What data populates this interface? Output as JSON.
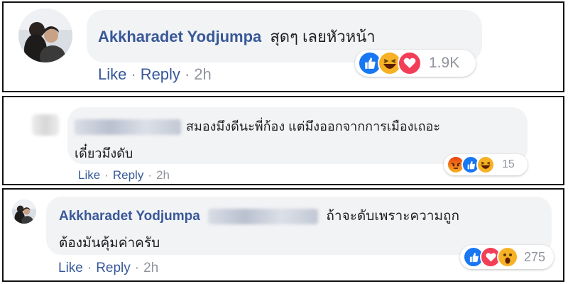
{
  "comments": [
    {
      "author": "Akkharadet Yodjumpa",
      "text": "สุดๆ เลยหัวหน้า",
      "actions": {
        "like": "Like",
        "reply": "Reply",
        "time": "2h"
      },
      "reactions": {
        "icons": [
          "like-icon",
          "haha-icon",
          "love-icon"
        ],
        "count": "1.9K"
      }
    },
    {
      "author": "",
      "text_line1": "สมองมึงดีนะพี่ก้อง แต่มึงออกจากการเมืองเถอะ",
      "text_line2": "เดี๋ยวมึงดับ",
      "actions": {
        "like": "Like",
        "reply": "Reply",
        "time": "2h"
      },
      "reactions": {
        "icons": [
          "angry-icon",
          "like-icon",
          "haha-icon"
        ],
        "count": "15"
      }
    },
    {
      "author": "Akkharadet Yodjumpa",
      "text_line1": "ถ้าจะดับเพราะความถูก",
      "text_line2": "ต้องมันคุ้มค่าครับ",
      "actions": {
        "like": "Like",
        "reply": "Reply",
        "time": "2h"
      },
      "reactions": {
        "icons": [
          "like-icon",
          "love-icon",
          "wow-icon"
        ],
        "count": "275"
      }
    }
  ],
  "colors": {
    "name": "#385898",
    "link": "#365899",
    "bubble": "#f2f3f5",
    "like": "#1877f2",
    "love": "#f33e58",
    "haha": "#f7b125",
    "angry": "#e9710f"
  }
}
